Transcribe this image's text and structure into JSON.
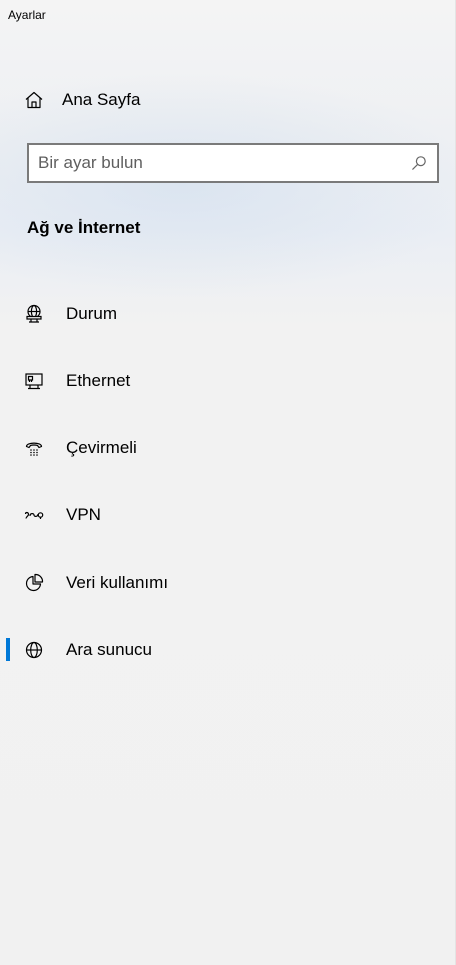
{
  "window": {
    "title": "Ayarlar"
  },
  "home": {
    "label": "Ana Sayfa",
    "icon": "home-icon"
  },
  "search": {
    "placeholder": "Bir ayar bulun",
    "value": "",
    "icon": "search-icon"
  },
  "section": {
    "title": "Ağ ve İnternet"
  },
  "nav": {
    "items": [
      {
        "label": "Durum",
        "icon": "globe-monitor-icon",
        "selected": false
      },
      {
        "label": "Ethernet",
        "icon": "ethernet-monitor-icon",
        "selected": false
      },
      {
        "label": "Çevirmeli",
        "icon": "dialup-phone-icon",
        "selected": false
      },
      {
        "label": "VPN",
        "icon": "vpn-icon",
        "selected": false
      },
      {
        "label": "Veri kullanımı",
        "icon": "pie-chart-icon",
        "selected": false
      },
      {
        "label": "Ara sunucu",
        "icon": "globe-icon",
        "selected": true
      }
    ]
  },
  "colors": {
    "accent": "#0078d7",
    "search_border": "#7a7a7a",
    "background": "#f0f0f0"
  }
}
